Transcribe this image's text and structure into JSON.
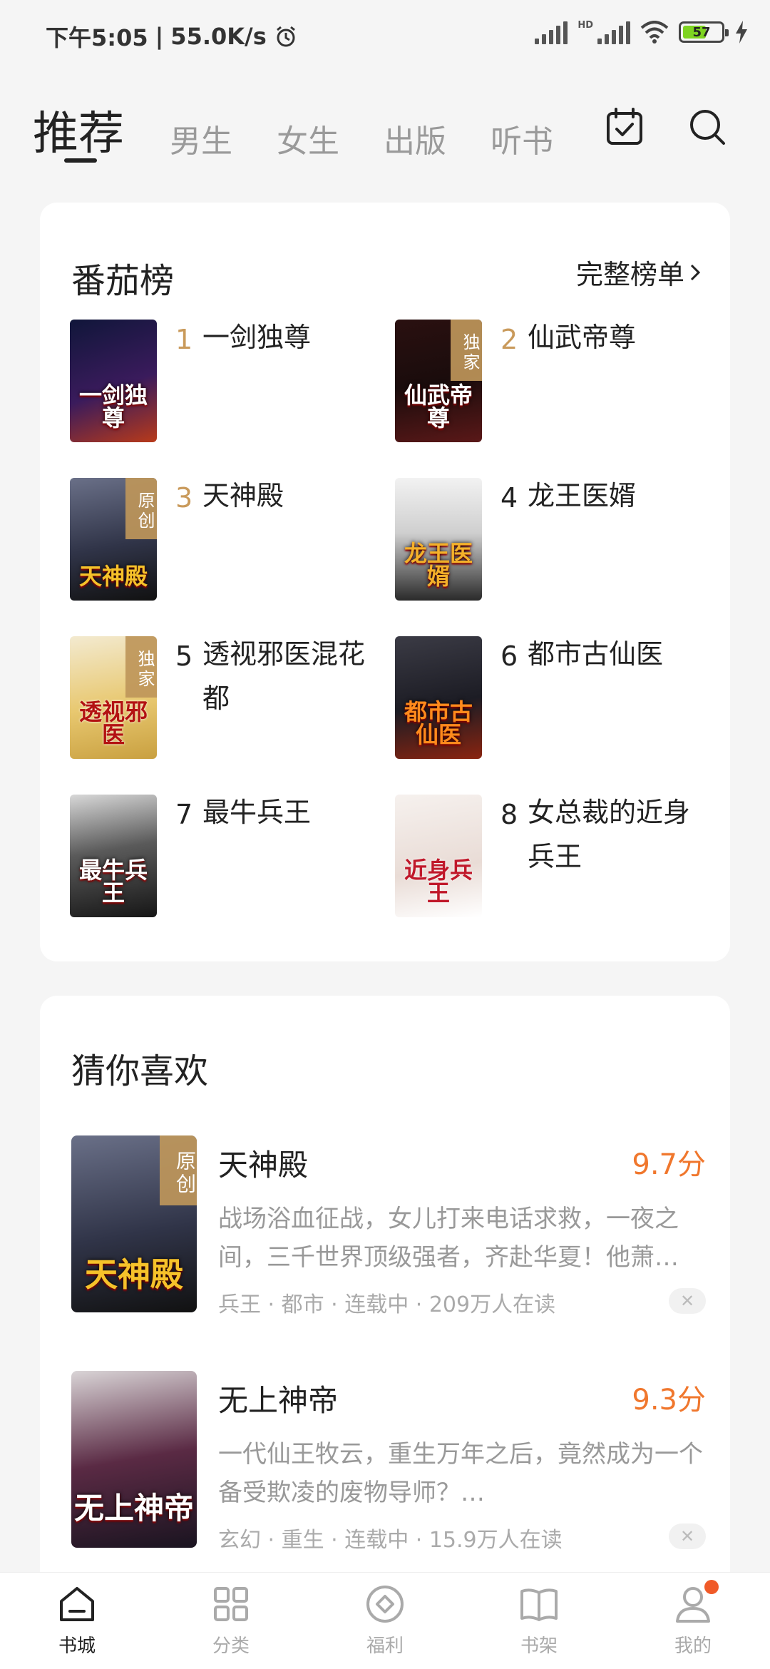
{
  "status_bar": {
    "time": "下午5:05",
    "speed": "55.0K/s",
    "network": "HD",
    "battery": "57"
  },
  "top_nav": {
    "tabs": [
      {
        "label": "推荐",
        "active": true
      },
      {
        "label": "男生"
      },
      {
        "label": "女生"
      },
      {
        "label": "出版"
      },
      {
        "label": "听书"
      }
    ],
    "icons": [
      "calendar-check-icon",
      "search-icon"
    ]
  },
  "ranking": {
    "title": "番茄榜",
    "more_label": "完整榜单",
    "items": [
      {
        "rank": "1",
        "name": "一剑独尊",
        "cover_text": "一剑独尊",
        "tag": "",
        "rank_color": "#c99a5b"
      },
      {
        "rank": "2",
        "name": "仙武帝尊",
        "cover_text": "仙武帝尊",
        "tag": "独家",
        "rank_color": "#c99a5b"
      },
      {
        "rank": "3",
        "name": "天神殿",
        "cover_text": "天神殿",
        "tag": "原创",
        "rank_color": "#c99a5b"
      },
      {
        "rank": "4",
        "name": "龙王医婿",
        "cover_text": "龙王医婿",
        "tag": "",
        "rank_color": "#222222"
      },
      {
        "rank": "5",
        "name": "透视邪医混花都",
        "cover_text": "透视邪医",
        "tag": "独家",
        "rank_color": "#222222"
      },
      {
        "rank": "6",
        "name": "都市古仙医",
        "cover_text": "都市古仙医",
        "tag": "",
        "rank_color": "#222222"
      },
      {
        "rank": "7",
        "name": "最牛兵王",
        "cover_text": "最牛兵王",
        "tag": "",
        "rank_color": "#222222"
      },
      {
        "rank": "8",
        "name": "女总裁的近身兵王",
        "cover_text": "近身兵王",
        "tag": "",
        "rank_color": "#222222"
      }
    ]
  },
  "recommend": {
    "title": "猜你喜欢",
    "items": [
      {
        "title": "天神殿",
        "score": "9.7分",
        "desc": "战场浴血征战，女儿打来电话求救，一夜之间，三千世界顶级强者，齐赴华夏！他萧…",
        "meta": "兵王 · 都市 · 连载中 · 209万人在读",
        "tag": "原创",
        "cover_text": "天神殿"
      },
      {
        "title": "无上神帝",
        "score": "9.3分",
        "desc": "一代仙王牧云，重生万年之后，竟然成为一个备受欺凌的废物导师？…",
        "meta": "玄幻 · 重生 · 连载中 · 15.9万人在读",
        "tag": "",
        "cover_text": "无上神帝"
      }
    ]
  },
  "bottom_bar": {
    "items": [
      {
        "label": "书城",
        "icon": "home-icon",
        "active": true
      },
      {
        "label": "分类",
        "icon": "grid-icon"
      },
      {
        "label": "福利",
        "icon": "diamond-coin-icon"
      },
      {
        "label": "书架",
        "icon": "book-open-icon"
      },
      {
        "label": "我的",
        "icon": "profile-icon",
        "badge": true
      }
    ]
  },
  "colors": {
    "accent": "#f0772d",
    "rank_gold": "#c99a5b",
    "badge": "#f05a28"
  }
}
